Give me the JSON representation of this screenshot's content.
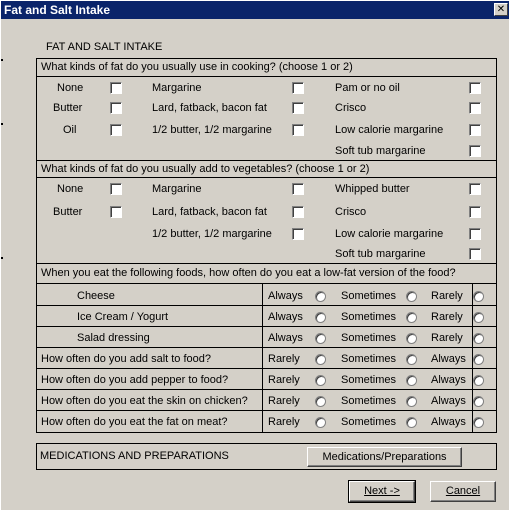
{
  "window": {
    "title": "Fat and Salt Intake",
    "close_glyph": "✕"
  },
  "heading": "FAT AND SALT INTAKE",
  "cooking": {
    "question": "What kinds of fat do you usually use in cooking? (choose 1 or 2)",
    "col1": [
      "None",
      "Butter",
      "Oil"
    ],
    "col2": [
      "Margarine",
      "Lard, fatback, bacon fat",
      "1/2 butter, 1/2 margarine"
    ],
    "col3": [
      "Pam or no oil",
      "Crisco",
      "Low calorie margarine",
      "Soft tub margarine"
    ]
  },
  "vegetables": {
    "question": "What kinds of fat do you usually add to vegetables? (choose 1 or 2)",
    "col1": [
      "None",
      "Butter"
    ],
    "col2": [
      "Margarine",
      "Lard, fatback, bacon fat",
      "1/2 butter, 1/2 margarine"
    ],
    "col3": [
      "Whipped butter",
      "Crisco",
      "Low calorie margarine",
      "Soft tub margarine"
    ]
  },
  "frequency": {
    "question": "When you eat the following foods, how often do you eat a low-fat version of the food?",
    "rows": [
      {
        "label": "Cheese",
        "opts": [
          "Always",
          "Sometimes",
          "Rarely"
        ]
      },
      {
        "label": "Ice Cream / Yogurt",
        "opts": [
          "Always",
          "Sometimes",
          "Rarely"
        ]
      },
      {
        "label": "Salad dressing",
        "opts": [
          "Always",
          "Sometimes",
          "Rarely"
        ]
      },
      {
        "label": "How often do you add salt to food?",
        "opts": [
          "Rarely",
          "Sometimes",
          "Always"
        ]
      },
      {
        "label": "How often do you add pepper to food?",
        "opts": [
          "Rarely",
          "Sometimes",
          "Always"
        ]
      },
      {
        "label": "How often do you eat the skin on chicken?",
        "opts": [
          "Rarely",
          "Sometimes",
          "Always"
        ]
      },
      {
        "label": "How often do you eat the fat on meat?",
        "opts": [
          "Rarely",
          "Sometimes",
          "Always"
        ]
      }
    ]
  },
  "medications": {
    "label": "MEDICATIONS AND PREPARATIONS",
    "button": "Medications/Preparations"
  },
  "buttons": {
    "next": "Next ->",
    "cancel": "Cancel"
  }
}
